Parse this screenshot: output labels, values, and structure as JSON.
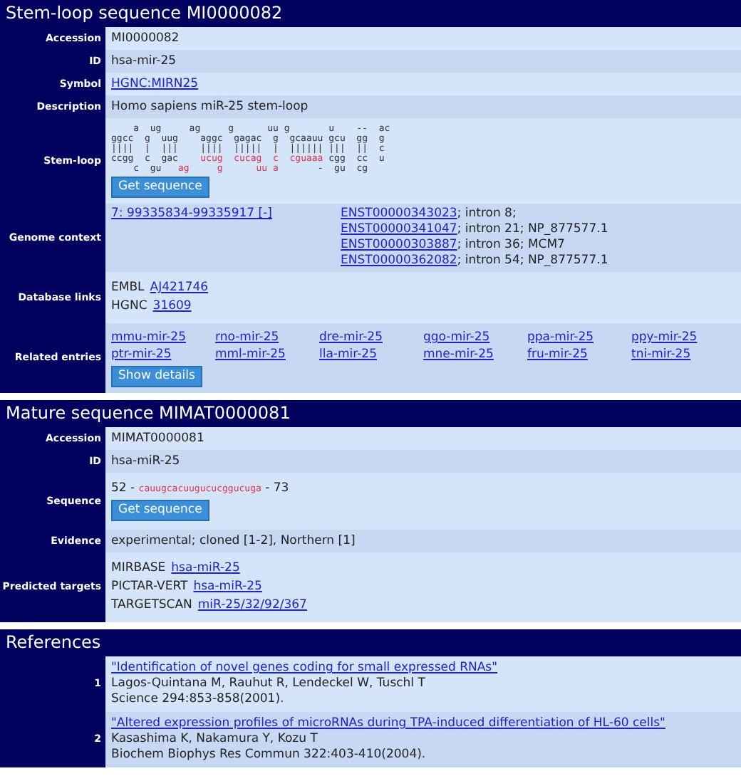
{
  "sections": [
    {
      "title": "Stem-loop sequence MI0000082",
      "rows": [
        {
          "label": "Accession",
          "kind": "text",
          "value": "MI0000082"
        },
        {
          "label": "ID",
          "kind": "text",
          "value": "hsa-mir-25"
        },
        {
          "label": "Symbol",
          "kind": "link",
          "value": "HGNC:MIRN25"
        },
        {
          "label": "Description",
          "kind": "text",
          "value": "Homo sapiens miR-25 stem-loop"
        },
        {
          "label": "Stem-loop",
          "kind": "stemloop",
          "button": "Get sequence",
          "lines": [
            [
              {
                "text": "    a  ug     ag     g      uu g       u    --  ac",
                "mature": false
              }
            ],
            [
              {
                "text": "ggcc  g  uug    aggc  gagac  g  gcaauu gcu  gg  g",
                "mature": false
              }
            ],
            [
              {
                "text": "||||  |  |||    ||||  |||||  |  |||||| |||  ||  c",
                "mature": false
              }
            ],
            [
              {
                "text": "ccgg  c  gac    ",
                "mature": false
              },
              {
                "text": "ucug  cucag  c  cguaaa",
                "mature": true
              },
              {
                "text": " cgg  cc  u",
                "mature": false
              }
            ],
            [
              {
                "text": "    c  gu   ",
                "mature": false
              },
              {
                "text": "ag     g      uu a",
                "mature": true
              },
              {
                "text": "       -  gu  cg",
                "mature": false
              }
            ]
          ]
        },
        {
          "label": "Genome context",
          "kind": "genome",
          "location": "7: 99335834-99335917 [-]",
          "transcripts": [
            {
              "link": "ENST00000343023",
              "note": "; intron 8;"
            },
            {
              "link": "ENST00000341047",
              "note": "; intron 21; NP_877577.1"
            },
            {
              "link": "ENST00000303887",
              "note": "; intron 36; MCM7"
            },
            {
              "link": "ENST00000362082",
              "note": "; intron 54; NP_877577.1"
            }
          ]
        },
        {
          "label": "Database links",
          "kind": "links",
          "items": [
            {
              "source": "EMBL",
              "link": "AJ421746"
            },
            {
              "source": "HGNC",
              "link": "31609"
            }
          ]
        },
        {
          "label": "Related entries",
          "kind": "related",
          "button": "Show details",
          "items": [
            "mmu-mir-25",
            "rno-mir-25",
            "dre-mir-25",
            "ggo-mir-25",
            "ppa-mir-25",
            "ppy-mir-25",
            "ptr-mir-25",
            "mml-mir-25",
            "lla-mir-25",
            "mne-mir-25",
            "fru-mir-25",
            "tni-mir-25"
          ]
        }
      ]
    },
    {
      "title": "Mature sequence MIMAT0000081",
      "rows": [
        {
          "label": "Accession",
          "kind": "text",
          "value": "MIMAT0000081"
        },
        {
          "label": "ID",
          "kind": "text",
          "value": "hsa-miR-25"
        },
        {
          "label": "Sequence",
          "kind": "sequence",
          "start": "52 - ",
          "sequence": "cauugcacuugucucggucuga",
          "end": " - 73",
          "button": "Get sequence"
        },
        {
          "label": "Evidence",
          "kind": "text",
          "value": "experimental; cloned [1-2], Northern [1]"
        },
        {
          "label": "Predicted targets",
          "kind": "links",
          "items": [
            {
              "source": "MIRBASE",
              "link": "hsa-miR-25"
            },
            {
              "source": "PICTAR-VERT",
              "link": "hsa-miR-25"
            },
            {
              "source": "TARGETSCAN",
              "link": "miR-25/32/92/367"
            }
          ]
        }
      ]
    },
    {
      "title": "References",
      "rows": [
        {
          "label": "1",
          "kind": "reference",
          "title": "\"Identification of novel genes coding for small expressed RNAs\"",
          "authors": "Lagos-Quintana M, Rauhut R, Lendeckel W, Tuschl T",
          "journal": "Science 294:853-858(2001)."
        },
        {
          "label": "2",
          "kind": "reference",
          "title": "\"Altered expression profiles of microRNAs during TPA-induced differentiation of HL-60 cells\"",
          "authors": "Kasashima K, Nakamura Y, Kozu T",
          "journal": "Biochem Biophys Res Commun 322:403-410(2004)."
        }
      ]
    }
  ]
}
